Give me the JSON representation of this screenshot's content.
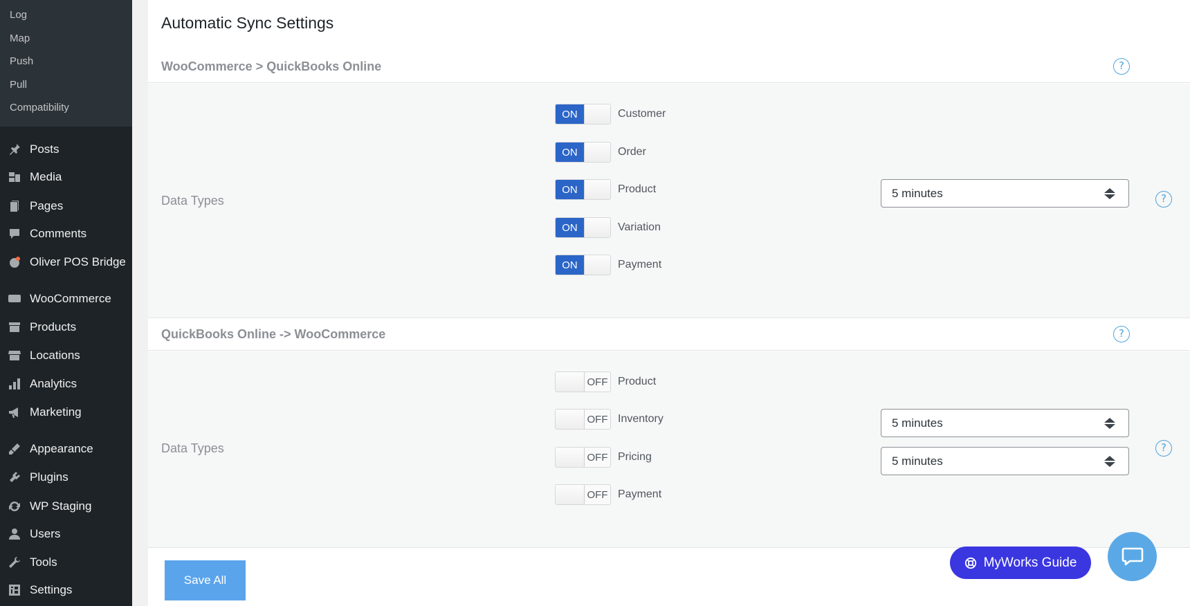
{
  "sidebar": {
    "submenu": [
      "Log",
      "Map",
      "Push",
      "Pull",
      "Compatibility"
    ],
    "items": [
      {
        "label": "Posts",
        "icon": "pin-icon"
      },
      {
        "label": "Media",
        "icon": "media-icon"
      },
      {
        "label": "Pages",
        "icon": "pages-icon"
      },
      {
        "label": "Comments",
        "icon": "comments-icon"
      },
      {
        "label": "Oliver POS Bridge",
        "icon": "oliver-icon"
      },
      {
        "label": "WooCommerce",
        "icon": "woo-icon"
      },
      {
        "label": "Products",
        "icon": "archive-icon"
      },
      {
        "label": "Locations",
        "icon": "store-icon"
      },
      {
        "label": "Analytics",
        "icon": "chart-icon"
      },
      {
        "label": "Marketing",
        "icon": "megaphone-icon"
      },
      {
        "label": "Appearance",
        "icon": "brush-icon"
      },
      {
        "label": "Plugins",
        "icon": "plugin-icon"
      },
      {
        "label": "WP Staging",
        "icon": "sync-icon"
      },
      {
        "label": "Users",
        "icon": "user-icon"
      },
      {
        "label": "Tools",
        "icon": "wrench-icon"
      },
      {
        "label": "Settings",
        "icon": "settings-icon"
      }
    ]
  },
  "main": {
    "title": "Automatic Sync Settings",
    "section1": {
      "title": "WooCommerce > QuickBooks Online",
      "data_types_label": "Data Types",
      "toggles": [
        {
          "label": "Customer",
          "state": "ON"
        },
        {
          "label": "Order",
          "state": "ON"
        },
        {
          "label": "Product",
          "state": "ON"
        },
        {
          "label": "Variation",
          "state": "ON"
        },
        {
          "label": "Payment",
          "state": "ON"
        }
      ],
      "interval": "5 minutes"
    },
    "section2": {
      "title": "QuickBooks Online -> WooCommerce",
      "data_types_label": "Data Types",
      "toggles": [
        {
          "label": "Product",
          "state": "OFF"
        },
        {
          "label": "Inventory",
          "state": "OFF"
        },
        {
          "label": "Pricing",
          "state": "OFF"
        },
        {
          "label": "Payment",
          "state": "OFF"
        }
      ],
      "inventory_interval": "5 minutes",
      "pricing_interval": "5 minutes"
    },
    "help_glyph": "?",
    "save_label": "Save All",
    "guide_label": "MyWorks Guide"
  },
  "colors": {
    "sidebar_bg": "#1d2327",
    "toggle_on": "#2b65c7",
    "save_button": "#5aa4ec",
    "guide_button": "#3a36e0",
    "help_icon": "#4ea3d9"
  }
}
